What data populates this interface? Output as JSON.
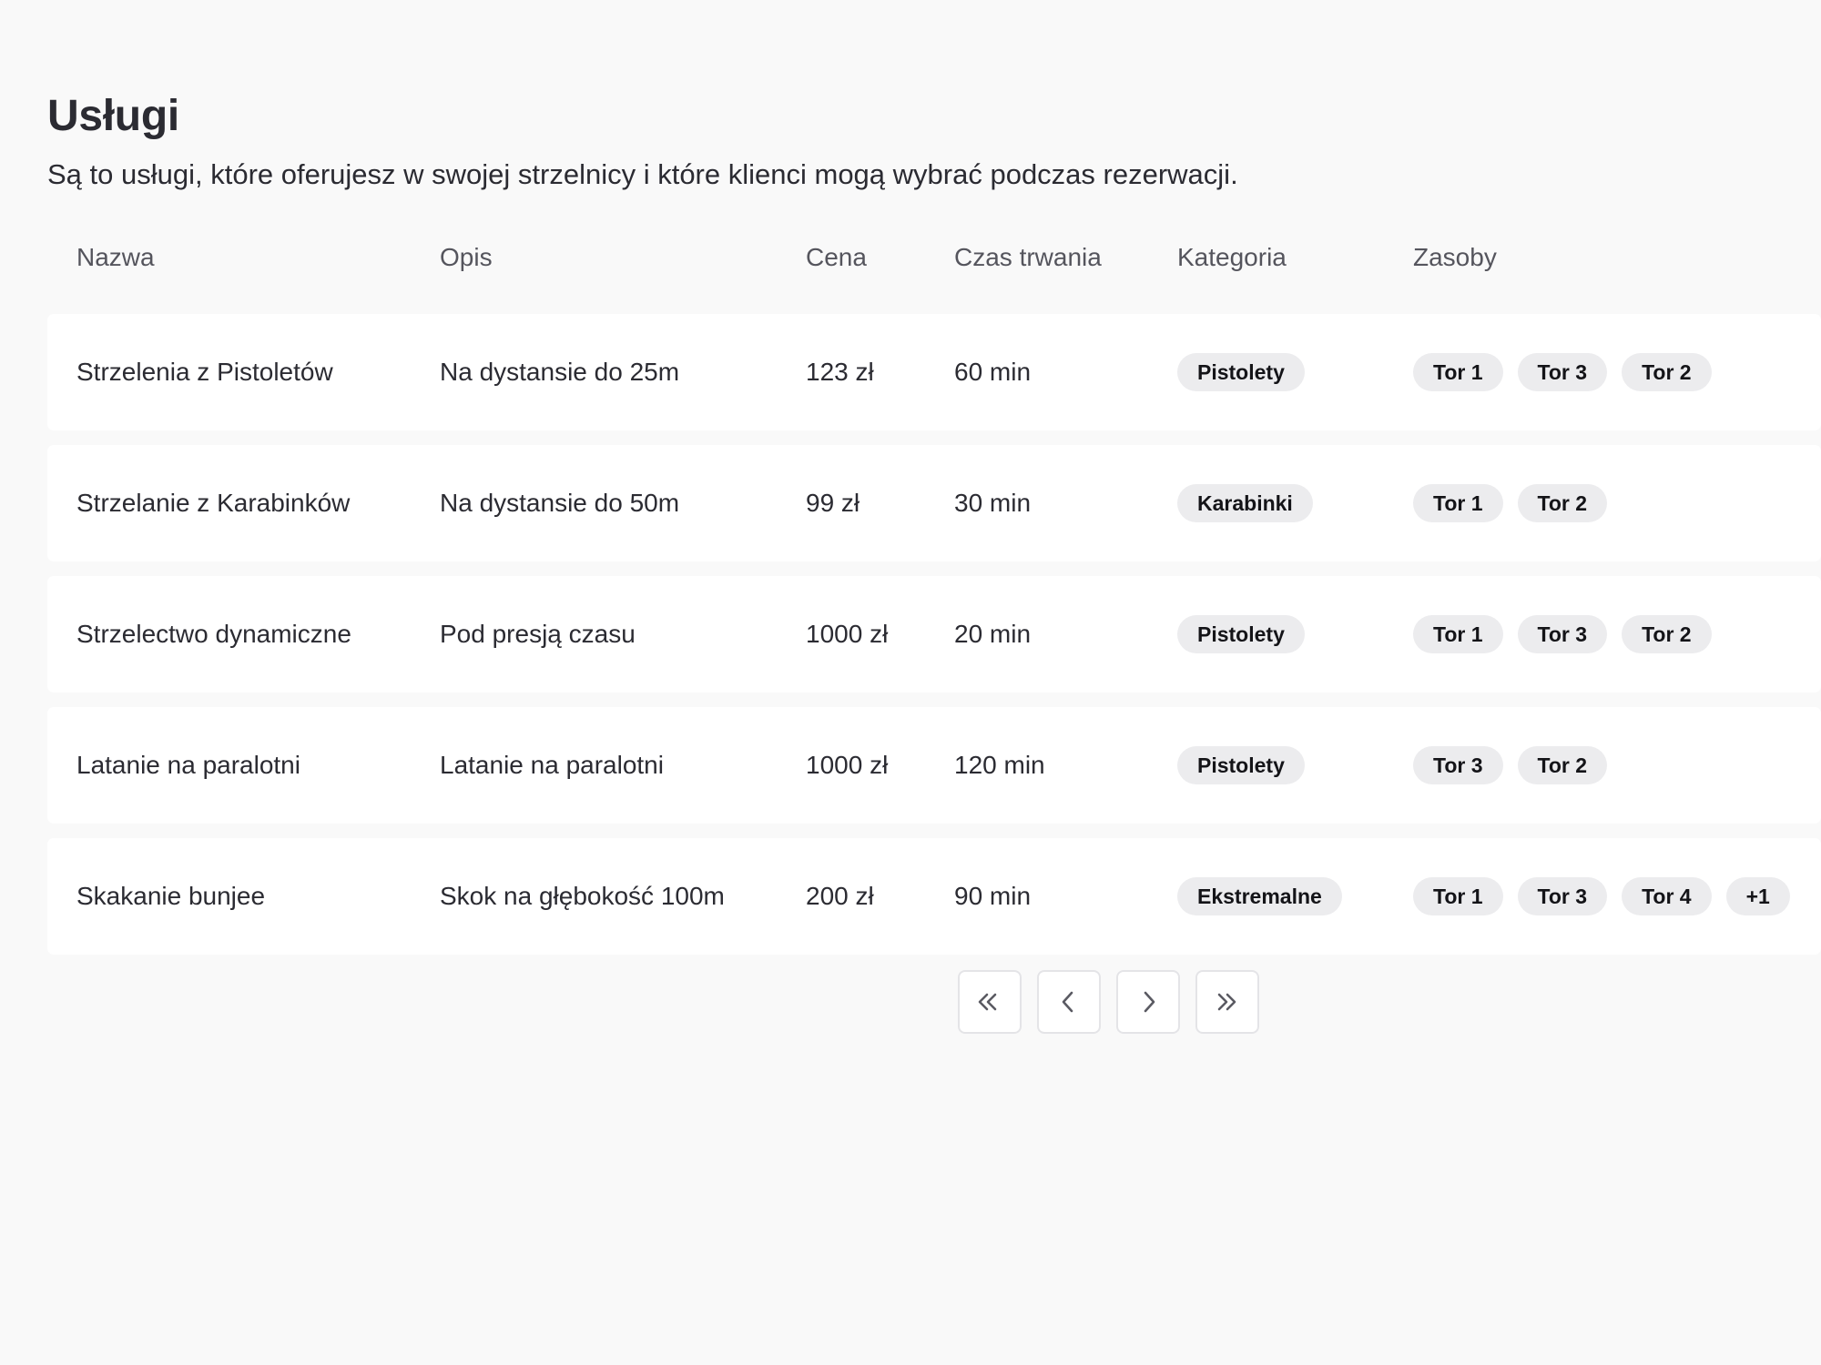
{
  "header": {
    "title": "Usługi",
    "subtitle": "Są to usługi, które oferujesz w swojej strzelnicy i które klienci mogą wybrać podczas rezerwacji."
  },
  "table": {
    "columns": [
      "Nazwa",
      "Opis",
      "Cena",
      "Czas trwania",
      "Kategoria",
      "Zasoby"
    ],
    "rows": [
      {
        "name": "Strzelenia z Pistoletów",
        "description": "Na dystansie do 25m",
        "price": "123 zł",
        "duration": "60 min",
        "category": "Pistolety",
        "resources": [
          "Tor 1",
          "Tor 3",
          "Tor 2"
        ]
      },
      {
        "name": "Strzelanie z Karabinków",
        "description": "Na dystansie do 50m",
        "price": "99 zł",
        "duration": "30 min",
        "category": "Karabinki",
        "resources": [
          "Tor 1",
          "Tor 2"
        ]
      },
      {
        "name": "Strzelectwo dynamiczne",
        "description": "Pod presją czasu",
        "price": "1000 zł",
        "duration": "20 min",
        "category": "Pistolety",
        "resources": [
          "Tor 1",
          "Tor 3",
          "Tor 2"
        ]
      },
      {
        "name": "Latanie na paralotni",
        "description": "Latanie na paralotni",
        "price": "1000 zł",
        "duration": "120 min",
        "category": "Pistolety",
        "resources": [
          "Tor 3",
          "Tor 2"
        ]
      },
      {
        "name": "Skakanie bunjee",
        "description": "Skok na głębokość 100m",
        "price": "200 zł",
        "duration": "90 min",
        "category": "Ekstremalne",
        "resources": [
          "Tor 1",
          "Tor 3",
          "Tor 4",
          "+1"
        ]
      }
    ]
  },
  "pagination": {
    "buttons": [
      {
        "name": "first-page-button",
        "icon": "chevrons-left-icon"
      },
      {
        "name": "previous-page-button",
        "icon": "chevron-left-icon"
      },
      {
        "name": "next-page-button",
        "icon": "chevron-right-icon"
      },
      {
        "name": "last-page-button",
        "icon": "chevrons-right-icon"
      }
    ]
  },
  "colors": {
    "background": "#f9f9f9",
    "row_background": "#ffffff",
    "pill_background": "#ececee",
    "text": "#2b2b32",
    "header_text": "#55555d"
  }
}
